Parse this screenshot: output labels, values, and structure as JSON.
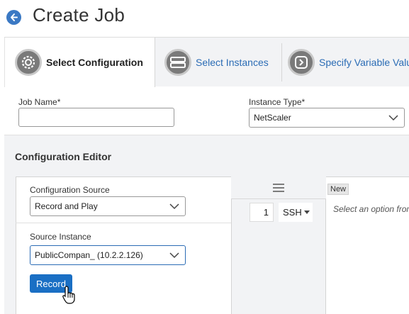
{
  "header": {
    "title": "Create Job"
  },
  "tabs": [
    {
      "label": "Select Configuration",
      "icon": "gear-icon",
      "active": true
    },
    {
      "label": "Select Instances",
      "icon": "server-icon",
      "active": false
    },
    {
      "label": "Specify Variable Valu",
      "icon": "chevron-right-icon",
      "active": false
    }
  ],
  "form": {
    "job_name_label": "Job Name*",
    "job_name_value": "",
    "instance_type_label": "Instance Type*",
    "instance_type_value": "NetScaler"
  },
  "config_editor": {
    "title": "Configuration Editor",
    "source_label": "Configuration Source",
    "source_value": "Record and Play",
    "instance_label": "Source Instance",
    "instance_value": "PublicCompan_ (10.2.2.126)",
    "record_label": "Record",
    "line_number": "1",
    "command_type": "SSH",
    "new_tag": "New",
    "placeholder": "Select an option from"
  },
  "colors": {
    "accent": "#1a6fc4",
    "link": "#2b6cb5",
    "focus": "#2b6cb5"
  }
}
